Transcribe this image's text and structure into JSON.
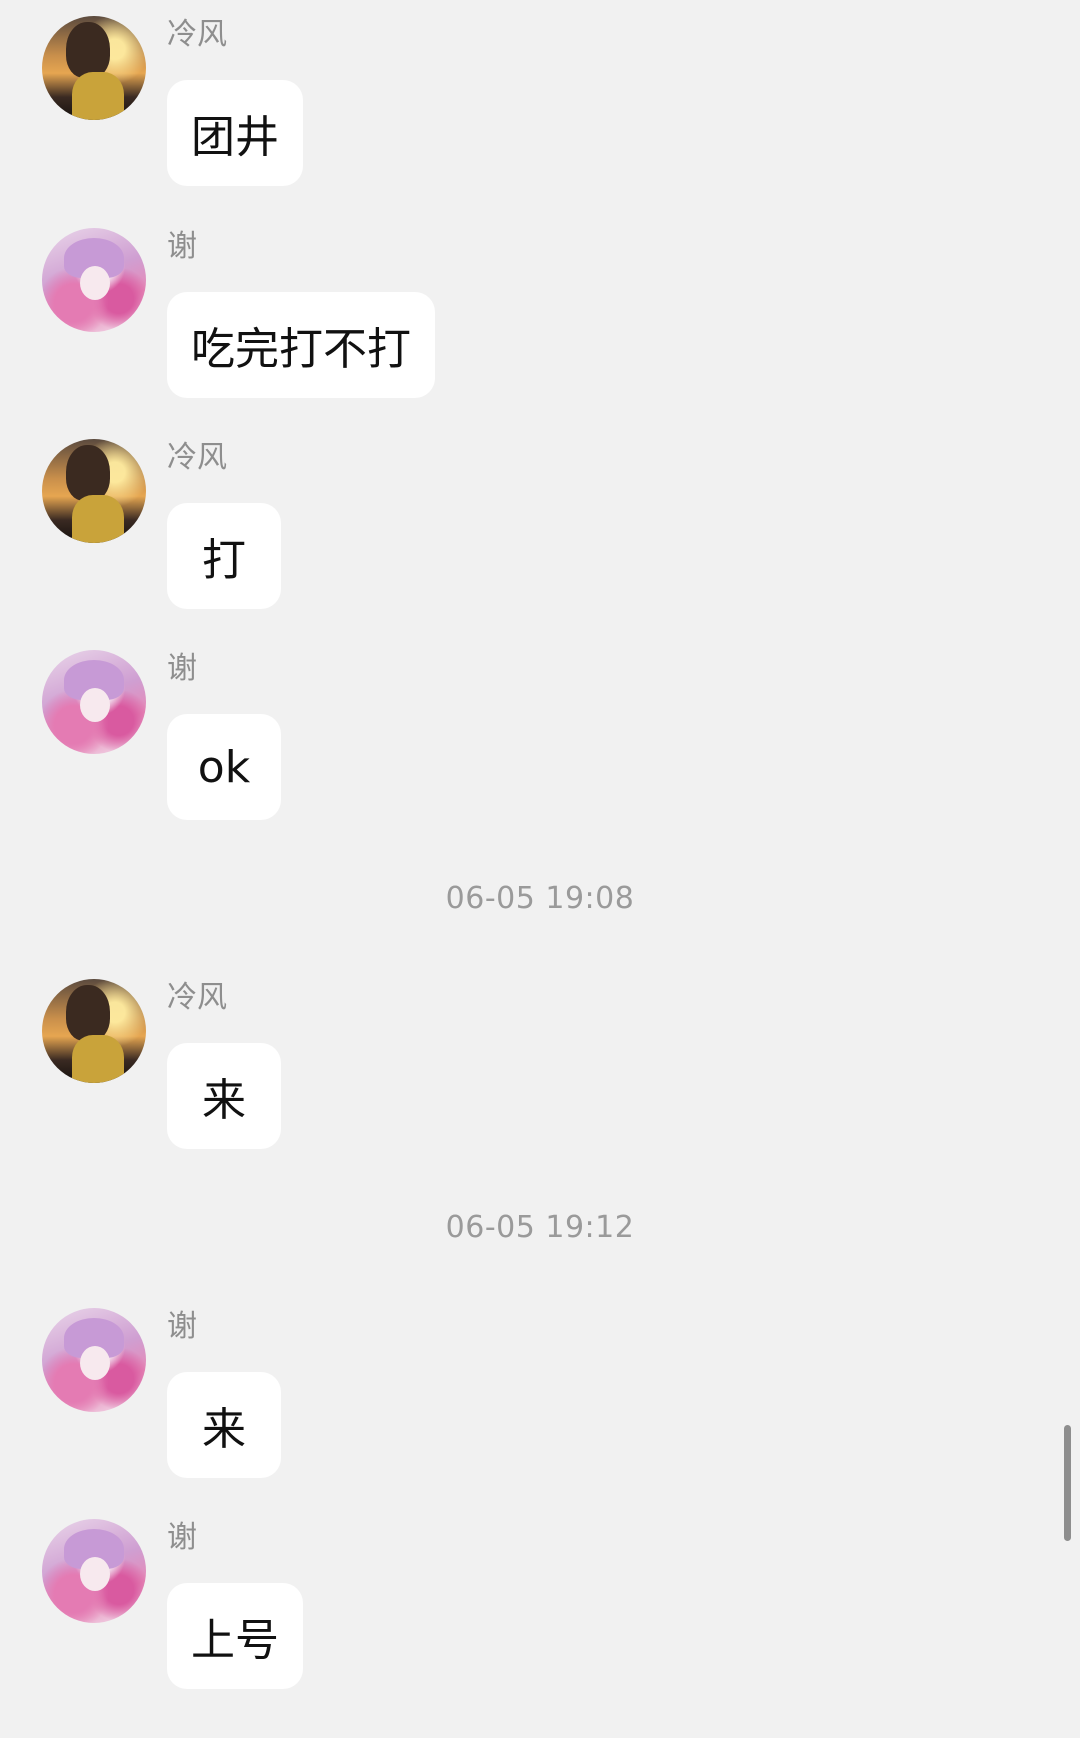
{
  "conversation": {
    "messages": [
      {
        "sender": "冷风",
        "avatar": "lengfeng-avatar",
        "text": "团井"
      },
      {
        "sender": "谢",
        "avatar": "xie-avatar",
        "text": "吃完打不打"
      },
      {
        "sender": "冷风",
        "avatar": "lengfeng-avatar",
        "text": "打"
      },
      {
        "sender": "谢",
        "avatar": "xie-avatar",
        "text": "ok"
      },
      {
        "sender": "冷风",
        "avatar": "lengfeng-avatar",
        "text": "来"
      },
      {
        "sender": "谢",
        "avatar": "xie-avatar",
        "text": "来"
      },
      {
        "sender": "谢",
        "avatar": "xie-avatar",
        "text": "上号"
      }
    ],
    "timestamps": [
      "06-05 19:08",
      "06-05 19:12"
    ]
  },
  "colors": {
    "background": "#f1f1f1",
    "bubble": "#ffffff",
    "sender_text": "#8e8e8e",
    "timestamp_text": "#9a9a9a",
    "message_text": "#111111"
  }
}
